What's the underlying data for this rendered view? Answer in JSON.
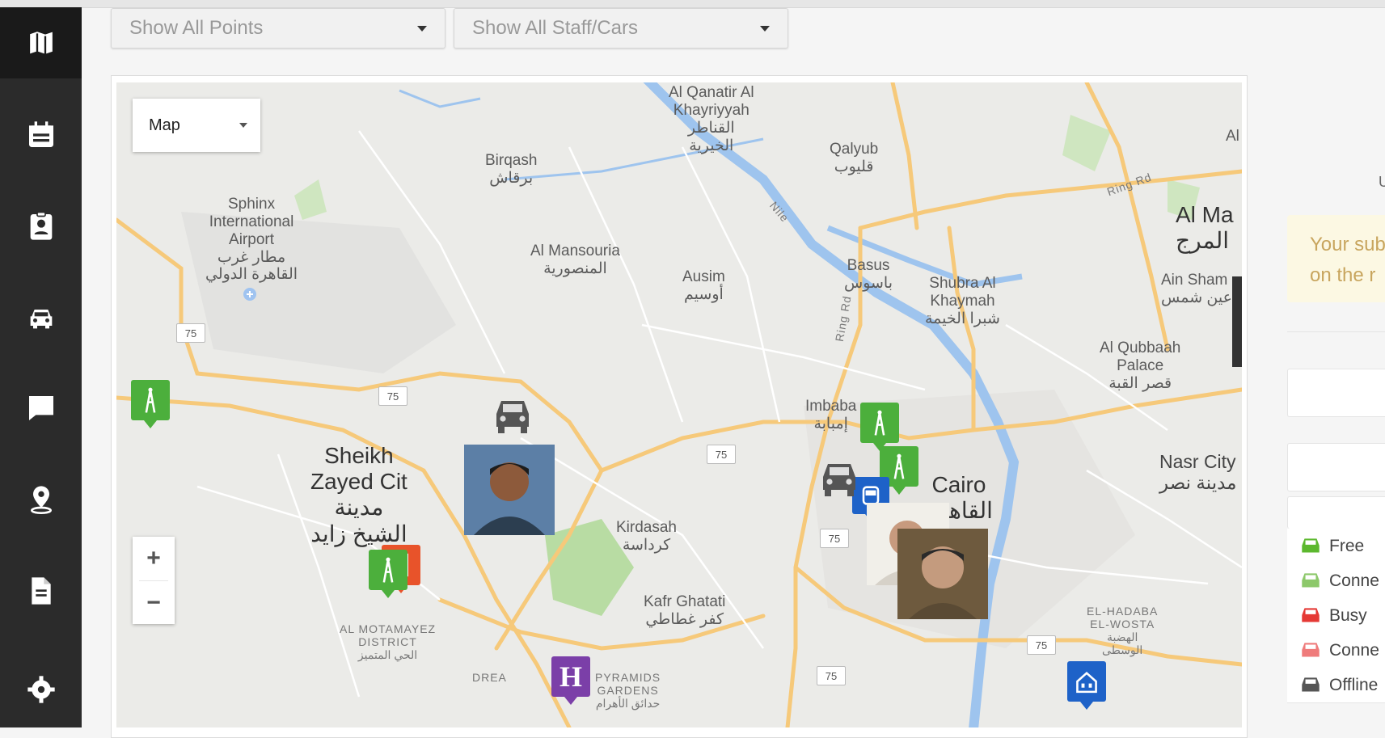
{
  "filters": {
    "points_label": "Show All Points",
    "staff_label": "Show All Staff/Cars"
  },
  "sidebar": {
    "items": [
      {
        "icon": "map-icon",
        "active": true
      },
      {
        "icon": "calendar-icon"
      },
      {
        "icon": "clipboard-user-icon"
      },
      {
        "icon": "car-icon"
      },
      {
        "icon": "chat-icon"
      },
      {
        "icon": "location-pin-icon"
      },
      {
        "icon": "document-icon"
      },
      {
        "icon": "gear-icon"
      }
    ]
  },
  "map": {
    "type_label": "Map",
    "zoom_in": "+",
    "zoom_out": "−",
    "places": {
      "qanatir": "Al Qanatir Al\nKhayriyyah\nالقناطر\nالخيرية",
      "qalyub": "Qalyub\nقليوب",
      "birqash": "Birqash\nبرقاش",
      "sphinx": "Sphinx\nInternational\nAirport\nمطار غرب\nالقاهرة الدولي",
      "mansouria": "Al Mansouria\nالمنصورية",
      "ausim": "Ausim\nأوسيم",
      "basus": "Basus\nباسوس",
      "shubra": "Shubra Al\nKhaymah\nشبرا الخيمة",
      "almarg": "Al Ma\nالمرج",
      "ainshams": "Ain Sham\nعين شمس",
      "qubbaah": "Al Qubbaah\nPalace\nقصر القبة",
      "imbaba": "Imbaba\nإمبابة",
      "sheikh": "Sheikh\nZayed Cit\nمدينة\nالشيخ زايد",
      "cairo": "Cairo\nالقاهرة",
      "nasr": "Nasr City\nمدينة نصر",
      "kirdasah": "Kirdasah\nكرداسة",
      "kafr": "Kafr Ghatati\nكفر غطاطي",
      "motamayez": "AL MOTAMAYEZ\nDISTRICT\nالحي المتميز",
      "dream": "DREA",
      "pyramids": "PYRAMIDS\nGARDENS\nحدائق الأهرام",
      "hadaba": "EL-HADABA\nEL-WOSTA\nالهضبة\nالوسطى",
      "al_top": "Al",
      "nile": "Nile",
      "ring": "Ring Rd",
      "ringv": "Ring Rd"
    },
    "road_shields": [
      "75",
      "75",
      "75",
      "75",
      "75",
      "75"
    ]
  },
  "right_panel": {
    "u_text": "U",
    "notice": "Your sub\non the r",
    "legend": [
      {
        "label": "Free",
        "color": "#5cb82e"
      },
      {
        "label": "Conne",
        "color": "#8cc86a"
      },
      {
        "label": "Busy",
        "color": "#e53935"
      },
      {
        "label": "Conne",
        "color": "#ef7b7b"
      },
      {
        "label": "Offline",
        "color": "#555555"
      }
    ]
  }
}
